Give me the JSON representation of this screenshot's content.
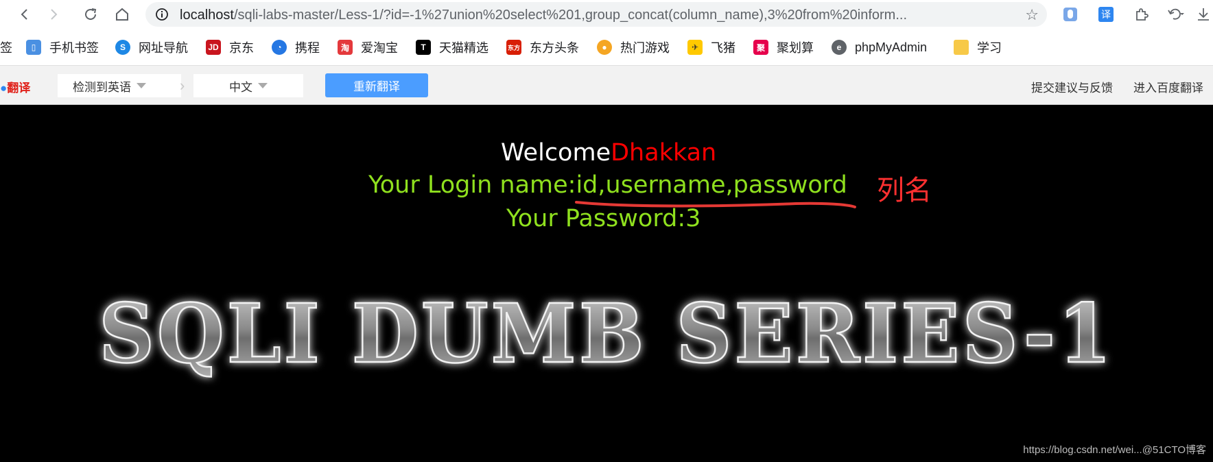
{
  "browser": {
    "url_host": "localhost",
    "url_path": "/sqli-labs-master/Less-1/?id=-1%27union%20select%201,group_concat(column_name),3%20from%20inform..."
  },
  "bookmarks": [
    {
      "label": "签",
      "icon": "bookmark-fragment"
    },
    {
      "label": "手机书签",
      "icon": "phone-icon",
      "color": "#4a90e2"
    },
    {
      "label": "网址导航",
      "icon": "navigation-icon",
      "color": "#1e88e5"
    },
    {
      "label": "京东",
      "icon": "jd-icon",
      "color": "#c9151e"
    },
    {
      "label": "携程",
      "icon": "ctrip-icon",
      "color": "#2577e3"
    },
    {
      "label": "爱淘宝",
      "icon": "taobao-icon",
      "color": "#e4393c"
    },
    {
      "label": "天猫精选",
      "icon": "tmall-icon",
      "color": "#d0021b"
    },
    {
      "label": "东方头条",
      "icon": "toutiao-icon",
      "color": "#d81e06"
    },
    {
      "label": "热门游戏",
      "icon": "game-icon",
      "color": "#f5a623"
    },
    {
      "label": "飞猪",
      "icon": "fliggy-icon",
      "color": "#ffc900"
    },
    {
      "label": "聚划算",
      "icon": "juhuasuan-icon",
      "color": "#e6004c"
    },
    {
      "label": "phpMyAdmin",
      "icon": "phpmyadmin-icon",
      "color": "#5f6368"
    },
    {
      "label": "学习",
      "icon": "folder-icon",
      "color": "#f7c948"
    }
  ],
  "translate": {
    "logo": "翻译",
    "source_lang": "检测到英语",
    "target_lang": "中文",
    "retranslate": "重新翻译",
    "feedback": "提交建议与反馈",
    "open_baidu": "进入百度翻译"
  },
  "page": {
    "welcome": "Welcome",
    "user": "Dhakkan",
    "login_label": "Your Login name:",
    "login_value": "id,username,password",
    "password_label": "Your Password:",
    "password_value": "3",
    "annotation": "列名",
    "banner": "SQLI DUMB SERIES-1",
    "watermark": "https://blog.csdn.net/wei...@51CTO博客"
  }
}
